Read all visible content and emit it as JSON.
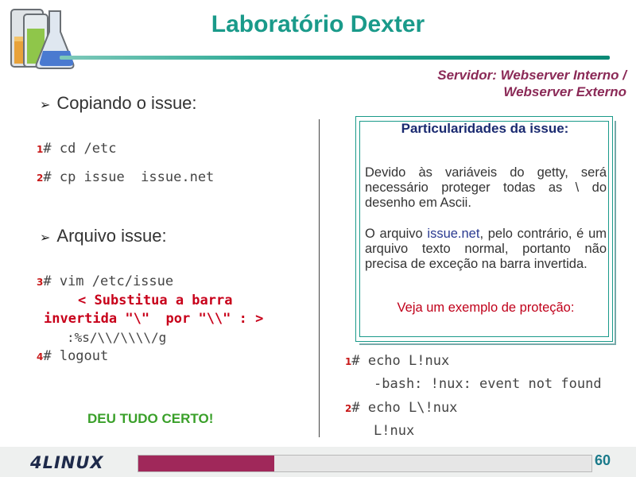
{
  "slide": {
    "title": "Laboratório Dexter",
    "server_line1": "Servidor: Webserver Interno /",
    "server_line2": "Webserver Externo",
    "page_number": "60",
    "progress_fraction": 0.3,
    "logo_text": "4LINUX"
  },
  "left": {
    "bullet1": "Copiando o issue:",
    "cmd1_num": "1",
    "cmd1": "# cd /etc",
    "cmd2_num": "2",
    "cmd2": "# cp issue  issue.net",
    "bullet2": "Arquivo issue:",
    "cmd3_num": "3",
    "cmd3": "# vim /etc/issue",
    "note_line1": "< Substitua a barra",
    "note_line2": "invertida \"\\\"  por \"\\\\\" : >",
    "sub_cmd": ":%s/\\\\/\\\\\\\\/g",
    "cmd4_num": "4",
    "cmd4": "# logout",
    "success": "DEU TUDO CERTO!"
  },
  "box": {
    "title": "Particularidades da issue:",
    "para1": "Devido às variáveis do getty, será necessário proteger todas as \\ do desenho em Ascii.",
    "para2_a": "O arquivo ",
    "para2_hl": "issue.net",
    "para2_b": ", pelo contrário, é um arquivo texto normal, portanto não precisa de exceção na barra invertida.",
    "example": "Veja um exemplo de proteção:"
  },
  "right": {
    "r1_num": "1",
    "r1": "# echo L!nux",
    "r1_out": "-bash: !nux: event not found",
    "r2_num": "2",
    "r2": "# echo L\\!nux",
    "r2_out": "L!nux"
  },
  "colors": {
    "title": "#1a9a8a",
    "server": "#8b2a57",
    "command_number": "#c81a1a",
    "note": "#c8001a",
    "success": "#3aa02a",
    "progress": "#a0285a"
  }
}
